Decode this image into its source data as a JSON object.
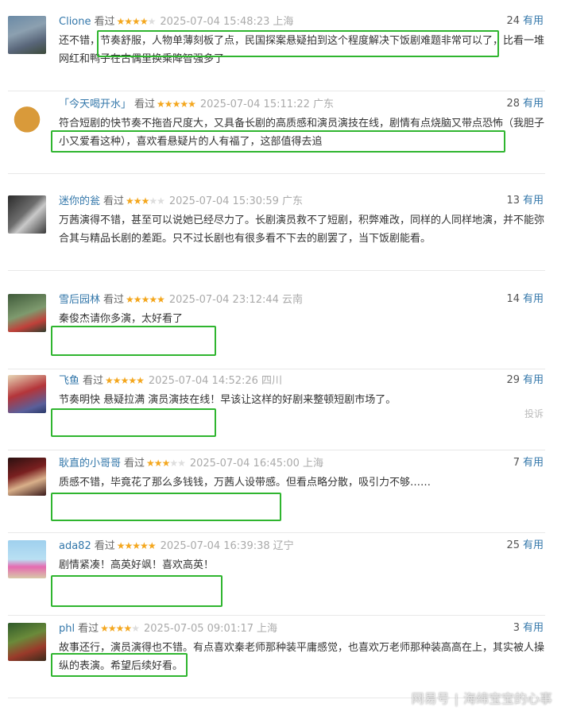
{
  "reviews": [
    {
      "user": "Clione",
      "watched": "看过",
      "stars": 4,
      "time": "2025-07-04 15:48:23",
      "location": "上海",
      "count": "24",
      "useful": "有用",
      "text": "还不错，节奏舒服，人物单薄刻板了点，民国探案悬疑拍到这个程度解决下饭剧难题非常可以了，比看一堆网红和鸭子在古偶里换乘降智强多了"
    },
    {
      "user": "「今天喝开水」",
      "watched": "看过",
      "stars": 5,
      "time": "2025-07-04 15:11:22",
      "location": "广东",
      "count": "28",
      "useful": "有用",
      "text": "符合短剧的快节奏不拖沓尺度大，又具备长剧的高质感和演员演技在线，剧情有点烧脑又带点恐怖（我胆子小又爱看这种），喜欢看悬疑片的人有福了，这部值得去追"
    },
    {
      "user": "迷你的瓮",
      "watched": "看过",
      "stars": 3,
      "time": "2025-07-04 15:30:59",
      "location": "广东",
      "count": "13",
      "useful": "有用",
      "text": "万茜演得不错，甚至可以说她已经尽力了。长剧演员救不了短剧，积弊难改，同样的人同样地演，并不能弥合其与精品长剧的差距。只不过长剧也有很多看不下去的剧罢了，当下饭剧能看。"
    },
    {
      "user": "雪后园林",
      "watched": "看过",
      "stars": 5,
      "time": "2025-07-04 23:12:44",
      "location": "云南",
      "count": "14",
      "useful": "有用",
      "text": "秦俊杰请你多演，太好看了"
    },
    {
      "user": "飞鱼",
      "watched": "看过",
      "stars": 5,
      "time": "2025-07-04 14:52:26",
      "location": "四川",
      "count": "29",
      "useful": "有用",
      "text": "节奏明快 悬疑拉满 演员演技在线！早该让这样的好剧来整顿短剧市场了。",
      "report": "投诉"
    },
    {
      "user": "耿直的小哥哥",
      "watched": "看过",
      "stars": 3,
      "time": "2025-07-04 16:45:00",
      "location": "上海",
      "count": "7",
      "useful": "有用",
      "text": "质感不错，毕竟花了那么多钱钱，万茜人设带感。但看点略分散，吸引力不够……"
    },
    {
      "user": "ada82",
      "watched": "看过",
      "stars": 5,
      "time": "2025-07-04 16:39:38",
      "location": "辽宁",
      "count": "25",
      "useful": "有用",
      "text": "剧情紧凑！高英好飒！喜欢高英！"
    },
    {
      "user": "phl",
      "watched": "看过",
      "stars": 4,
      "time": "2025-07-05 09:01:17",
      "location": "上海",
      "count": "3",
      "useful": "有用",
      "text": "故事还行，演员演得也不错。有点喜欢秦老师那种装平庸感觉，也喜欢万老师那种装高高在上，其实被人操纵的表演。希望后续好看。"
    }
  ],
  "watermark": {
    "platform": "网易号",
    "author": "海绵宝宝的心事"
  },
  "colors": {
    "username": "#3377aa",
    "star": "#f4a71e",
    "highlight": "#2fb52f"
  },
  "icons": {
    "star": "star-icon",
    "avatar": "avatar"
  }
}
